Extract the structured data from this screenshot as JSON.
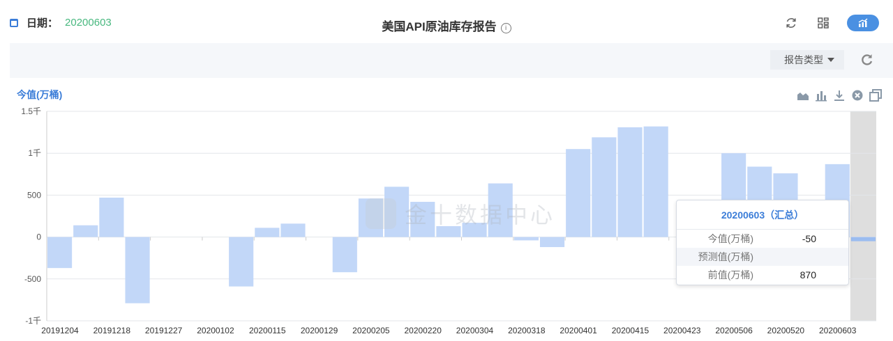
{
  "header": {
    "date_label": "日期：",
    "date_value": "20200603",
    "title": "美国API原油库存报告",
    "info_glyph": "i",
    "icons": [
      "refresh-icon",
      "grid-icon",
      "chart-icon"
    ]
  },
  "toolbar": {
    "report_type_label": "报告类型"
  },
  "chart_data": {
    "type": "bar",
    "title": "今值(万桶)",
    "ylabel": "",
    "ylim": [
      -1000,
      1500
    ],
    "yticks": [
      -1000,
      -500,
      0,
      500,
      1000,
      1500
    ],
    "ytick_labels": [
      "-1千",
      "-500",
      "0",
      "500",
      "1千",
      "1.5千"
    ],
    "xtick_labels": [
      "20191204",
      "20191218",
      "20191227",
      "20200102",
      "20200115",
      "20200129",
      "20200205",
      "20200220",
      "20200304",
      "20200318",
      "20200401",
      "20200415",
      "20200423",
      "20200506",
      "20200520",
      "20200603"
    ],
    "values": [
      -370,
      140,
      470,
      -790,
      null,
      null,
      null,
      -590,
      110,
      160,
      null,
      -420,
      460,
      600,
      420,
      130,
      170,
      640,
      -40,
      -120,
      1050,
      1190,
      1310,
      1320,
      null,
      null,
      1000,
      840,
      760,
      null,
      870,
      -50
    ],
    "highlight_index": 31,
    "bar_color": "#c2d7f8",
    "highlight_bg": "#dedede",
    "tools": [
      "line-chart-icon",
      "bar-chart-icon",
      "download-icon",
      "close-icon",
      "copy-icon"
    ]
  },
  "tooltip": {
    "title": "20200603（汇总）",
    "rows": [
      {
        "label": "今值(万桶)",
        "value": "-50"
      },
      {
        "label": "预测值(万桶)",
        "value": ""
      },
      {
        "label": "前值(万桶)",
        "value": "870"
      }
    ]
  },
  "watermark": "金十数据中心"
}
